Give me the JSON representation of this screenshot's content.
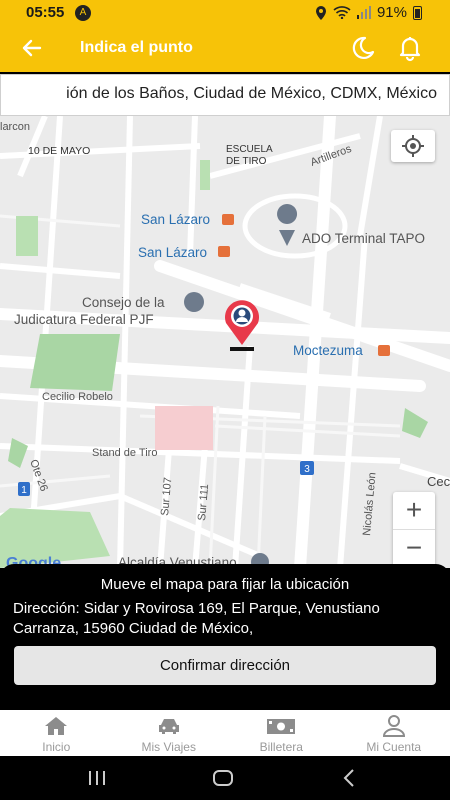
{
  "status": {
    "time": "05:55",
    "nav_badge": "A",
    "battery": "91%"
  },
  "header": {
    "title": "Indica el punto"
  },
  "search": {
    "value": "ión de los Baños, Ciudad de México, CDMX, México"
  },
  "map": {
    "labels": {
      "arcon": "larcon",
      "mayo": "10 DE MAYO",
      "escuela1": "ESCUELA",
      "escuela2": "DE TIRO",
      "artilleros": "Artilleros",
      "sanlazaro1": "San Lázaro",
      "sanlazaro2": "San Lázaro",
      "ado": "ADO Terminal TAPO",
      "consejo1": "Consejo de la",
      "consejo2": "Judicatura Federal PJF",
      "moctezuma": "Moctezuma",
      "cecilio": "Cecilio Robelo",
      "standtiro": "Stand de Tiro",
      "oteb": "Ote 26",
      "sur107": "Sur 107",
      "sur111": "Sur 111",
      "nicolas": "Nicolás León",
      "alcaldia": "Alcaldía Venustiano",
      "cec": "Cec",
      "metro": "M",
      "shield3": "3",
      "shield1": "1",
      "google": "Google"
    },
    "zoom_in": "+",
    "zoom_out": "−"
  },
  "panel": {
    "hint": "Mueve el mapa para fijar la ubicación",
    "address": "Dirección: Sidar y Rovirosa 169, El Parque, Venustiano Carranza, 15960 Ciudad de México,",
    "confirm": "Confirmar dirección"
  },
  "nav": [
    {
      "label": "Inicio",
      "icon": "home-icon"
    },
    {
      "label": "Mis Viajes",
      "icon": "car-icon"
    },
    {
      "label": "Billetera",
      "icon": "wallet-icon"
    },
    {
      "label": "Mi Cuenta",
      "icon": "user-icon"
    }
  ],
  "colors": {
    "accent": "#f7c308",
    "pin": "#e8394a",
    "metro": "#e5703a",
    "poi": "#6e7b8c"
  }
}
